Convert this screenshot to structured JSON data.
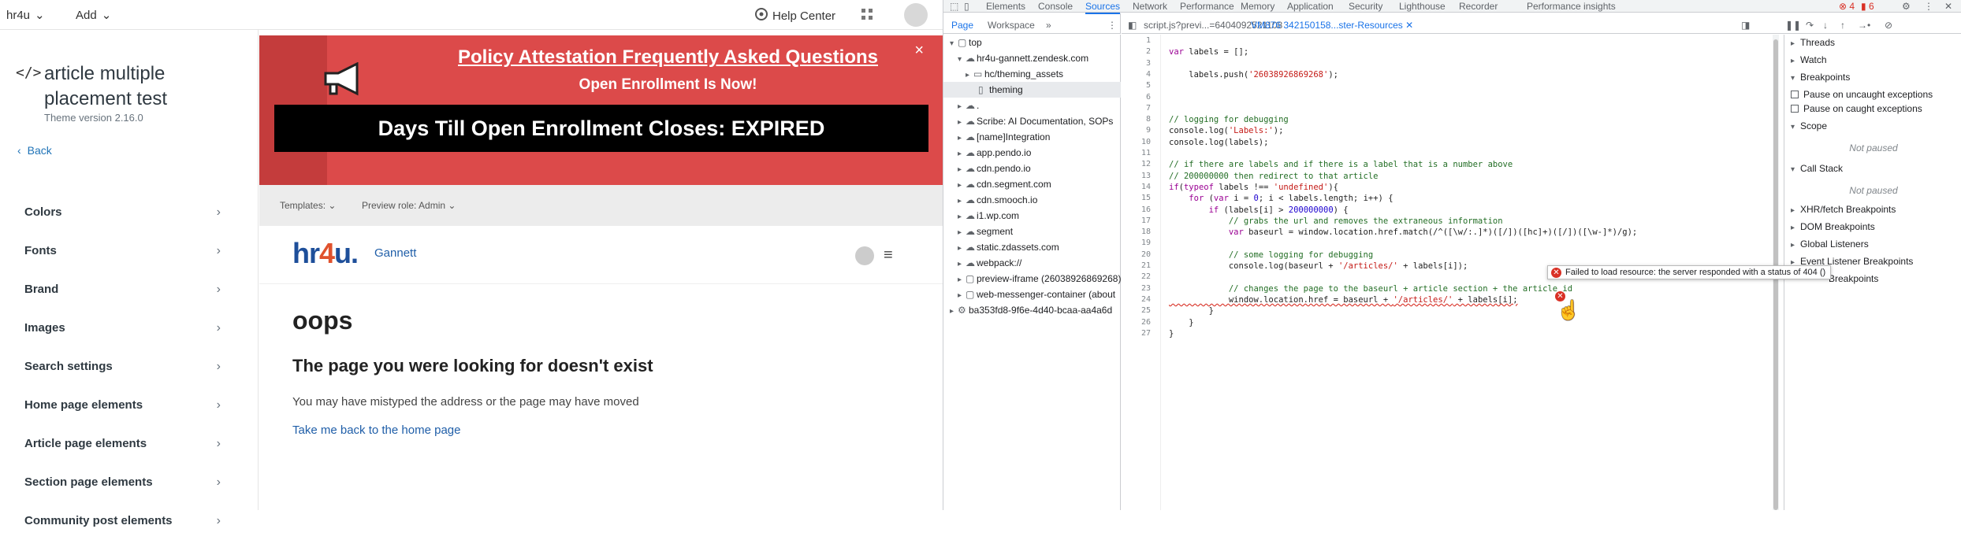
{
  "topbar": {
    "brand": "hr4u",
    "add": "Add",
    "help": "Help Center"
  },
  "theme": {
    "title": "article multiple placement test",
    "version": "Theme version 2.16.0",
    "back": "Back",
    "items": [
      {
        "label": "Colors"
      },
      {
        "label": "Fonts"
      },
      {
        "label": "Brand"
      },
      {
        "label": "Images"
      },
      {
        "label": "Search settings"
      },
      {
        "label": "Home page elements"
      },
      {
        "label": "Article page elements"
      },
      {
        "label": "Section page elements"
      },
      {
        "label": "Community post elements"
      }
    ]
  },
  "banner": {
    "title": "Policy Attestation Frequently Asked Questions",
    "subtitle": "Open Enrollment Is Now!",
    "close": "×",
    "days": "Days Till Open Enrollment Closes: EXPIRED"
  },
  "controls": {
    "templates": "Templates:",
    "preview_role": "Preview role: Admin"
  },
  "site": {
    "logo_a": "hr",
    "logo_b": "4",
    "logo_c": "u.",
    "brand": "Gannett",
    "oops": "oops",
    "heading": "The page you were looking for doesn't exist",
    "message": "You may have mistyped the address or the page may have moved",
    "home_link": "Take me back to the home page"
  },
  "devtools": {
    "tabs": [
      "Elements",
      "Console",
      "Sources",
      "Network",
      "Performance",
      "Memory",
      "Application",
      "Security",
      "Lighthouse",
      "Recorder",
      "Performance insights"
    ],
    "active_tab": "Sources",
    "error_count": "4",
    "warn_count": "6",
    "nav_tabs": [
      "Page",
      "Workspace"
    ],
    "editor_tabs": [
      "script.js?previ...=6404092521108",
      "VM876 342150158...ster-Resources"
    ],
    "tree": [
      "top",
      "hr4u-gannett.zendesk.com",
      "hc/theming_assets",
      "theming",
      ".",
      "Scribe: AI Documentation, SOPs",
      "[name]Integration",
      "app.pendo.io",
      "cdn.pendo.io",
      "cdn.segment.com",
      "cdn.smooch.io",
      "i1.wp.com",
      "segment",
      "static.zdassets.com",
      "webpack://",
      "preview-iframe (26038926869268)",
      "web-messenger-container (about",
      "ba353fd8-9f6e-4d40-bcaa-aa4a6d"
    ],
    "code_lines": [
      "",
      "var labels = [];",
      "",
      "    labels.push('26038926869268');",
      "",
      "",
      "",
      "// logging for debugging",
      "console.log('Labels:');",
      "console.log(labels);",
      "",
      "// if there are labels and if there is a label that is a number above",
      "// 200000000 then redirect to that article",
      "if(typeof labels !== 'undefined'){",
      "    for (var i = 0; i < labels.length; i++) {",
      "        if (labels[i] > 200000000) {",
      "            // grabs the url and removes the extraneous information",
      "            var baseurl = window.location.href.match(/^([\\w/:.]*)([/])([hc]+)([/])([\\w-]*)/g);",
      "",
      "            // some logging for debugging",
      "            console.log(baseurl + '/articles/' + labels[i]);",
      "",
      "            // changes the page to the baseurl + article section + the article id",
      "            window.location.href = baseurl + '/articles/' + labels[i];",
      "        }",
      "    }",
      "}"
    ],
    "tooltip": "Failed to load resource: the server responded with a status of 404 ()",
    "debug": {
      "threads": "Threads",
      "watch": "Watch",
      "breakpoints": "Breakpoints",
      "pause_uncaught": "Pause on uncaught exceptions",
      "pause_caught": "Pause on caught exceptions",
      "scope": "Scope",
      "not_paused": "Not paused",
      "call_stack": "Call Stack",
      "not_paused_2": "Not paused",
      "xhr": "XHR/fetch Breakpoints",
      "dom": "DOM Breakpoints",
      "global": "Global Listeners",
      "event": "Event Listener Breakpoints",
      "csp": "Breakpoints"
    }
  }
}
